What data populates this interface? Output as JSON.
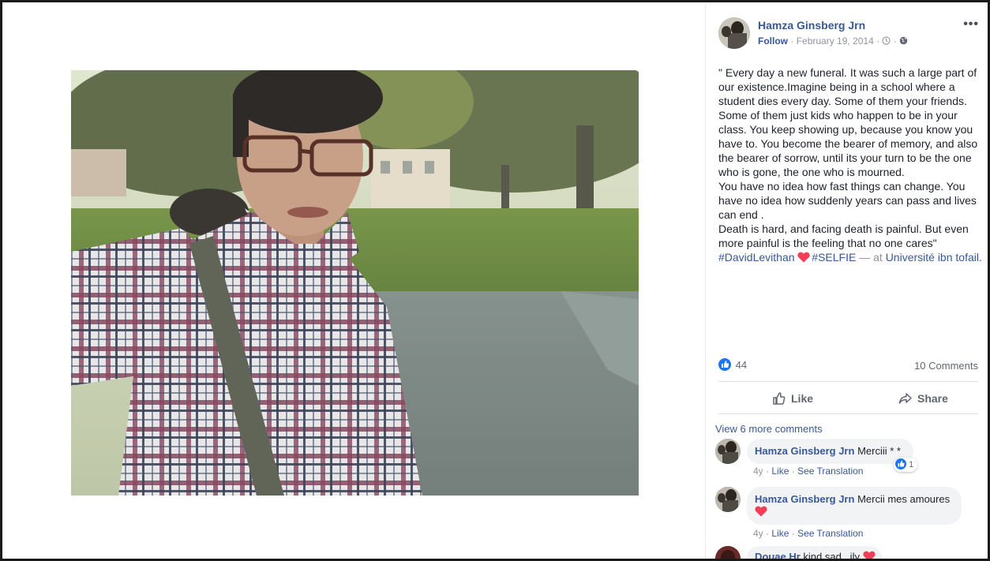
{
  "post": {
    "author": "Hamza Ginsberg Jrn",
    "follow_label": "Follow",
    "date": "February 19, 2014",
    "more_icon": "more-options-icon",
    "text_lines": [
      "\" Every day a new funeral. It was such a large part of our existence.Imagine being in a school where a student dies every day. Some of them your friends. Some of them just kids who happen to be in your class. You keep showing up, because you know you have to. You become the bearer of memory, and also the bearer of sorrow, until its your turn to be the one who is gone, the one who is mourned.",
      "You have no idea how fast things can change. You have no idea how suddenly years can pass and lives can end .",
      "Death is hard, and facing death is painful. But even more painful is the feeling that no one cares\""
    ],
    "hashtag1": "#DavidLevithan",
    "hashtag2": "#SELFIE",
    "at_prefix": " — at ",
    "place": "Université ibn tofail.",
    "reaction_count": "44",
    "comments_count": "10 Comments",
    "like_label": "Like",
    "share_label": "Share"
  },
  "comments": {
    "view_more": "View 6 more comments",
    "items": [
      {
        "name": "Hamza Ginsberg Jrn",
        "text": "Merciii * *",
        "age": "4y",
        "like": "Like",
        "translate": "See Translation",
        "reactions": "1"
      },
      {
        "name": "Hamza Ginsberg Jrn",
        "text": "Mercii mes amoures",
        "age": "4y",
        "like": "Like",
        "translate": "See Translation"
      },
      {
        "name": "Douae Hr",
        "text": "kind sad...ily"
      }
    ]
  },
  "colors": {
    "link": "#385898",
    "like_blue": "#1877f2",
    "heart_red": "#f33e58"
  }
}
